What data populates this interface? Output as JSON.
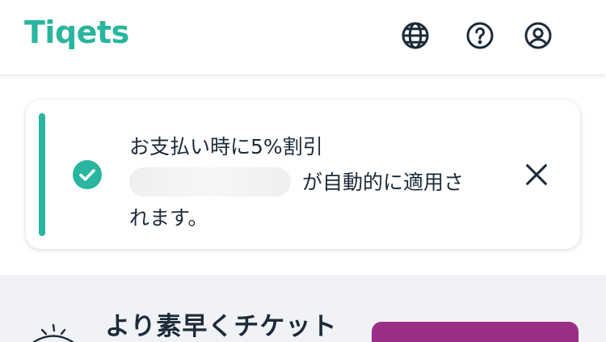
{
  "header": {
    "logo_text": "Tiqets",
    "icons": [
      "globe-icon",
      "help-icon",
      "account-icon"
    ]
  },
  "toast": {
    "line1": "お支払い時に5%割引",
    "line2_suffix": "が自動的に適用さ",
    "line3": "れます。",
    "icons": [
      "check-circle-icon",
      "close-icon"
    ]
  },
  "promo": {
    "title": "より素早くチケット"
  },
  "colors": {
    "brand_teal": "#29b59f",
    "text_dark": "#1c2b39",
    "promo_button": "#9b2f86",
    "promo_bg": "#f1f2f6"
  }
}
